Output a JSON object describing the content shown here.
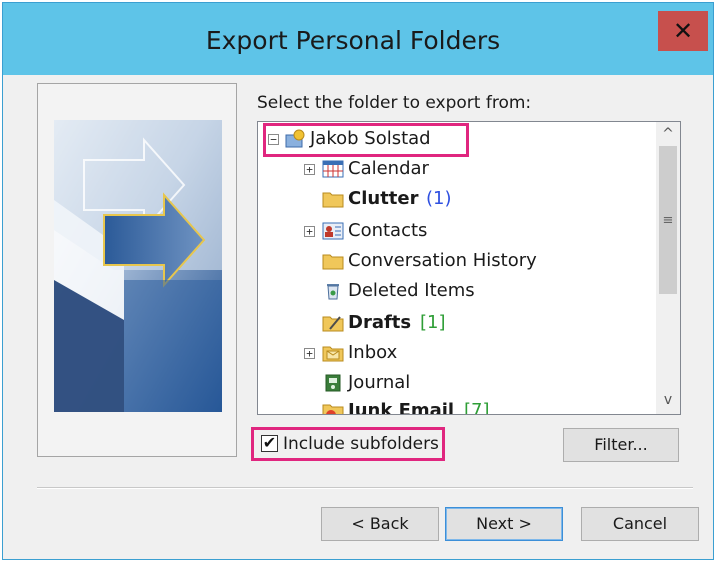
{
  "window": {
    "title": "Export Personal Folders",
    "close_glyph": "✕"
  },
  "prompt": "Select the folder to export from:",
  "tree": {
    "root": {
      "label": "Jakob Solstad",
      "icon": "mailbox-icon",
      "expander": "−"
    },
    "items": [
      {
        "label": "Calendar",
        "icon": "calendar-icon",
        "expander": "+",
        "count": ""
      },
      {
        "label": "Clutter",
        "icon": "folder-icon",
        "expander": "",
        "count": "(1)"
      },
      {
        "label": "Contacts",
        "icon": "contacts-icon",
        "expander": "+",
        "count": ""
      },
      {
        "label": "Conversation History",
        "icon": "folder-icon",
        "expander": "",
        "count": ""
      },
      {
        "label": "Deleted Items",
        "icon": "trash-icon",
        "expander": "",
        "count": ""
      },
      {
        "label": "Drafts",
        "icon": "drafts-icon",
        "expander": "",
        "count": "[1]"
      },
      {
        "label": "Inbox",
        "icon": "inbox-icon",
        "expander": "+",
        "count": ""
      },
      {
        "label": "Journal",
        "icon": "journal-icon",
        "expander": "",
        "count": ""
      },
      {
        "label": "Junk Email",
        "icon": "junk-icon",
        "expander": "",
        "count": "[7]"
      }
    ],
    "scroll_up": "^",
    "scroll_down": "v",
    "thumb_grip": "≡"
  },
  "include_subfolders": {
    "label": "Include subfolders",
    "checked": true,
    "check_glyph": "✔"
  },
  "buttons": {
    "filter": "Filter...",
    "back": "< Back",
    "next": "Next >",
    "cancel": "Cancel"
  },
  "colors": {
    "titlebar": "#5ec4e8",
    "close": "#c7504d",
    "highlight": "#e0267f"
  }
}
